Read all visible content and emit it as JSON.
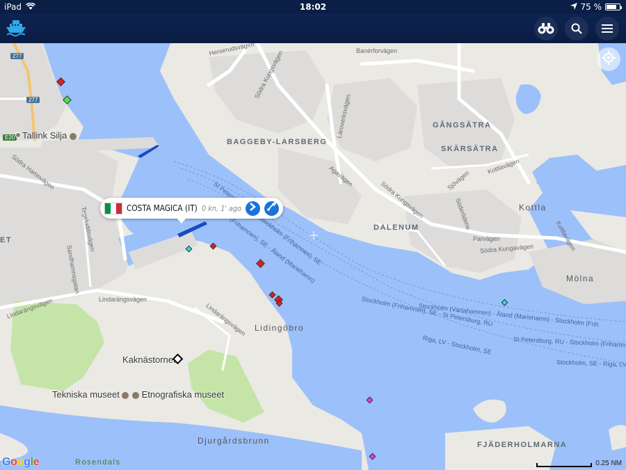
{
  "status_bar": {
    "device": "iPad",
    "time": "18:02",
    "battery_text": "75 %",
    "battery_level": 0.75
  },
  "toolbar": {
    "logo_icon": "ship-logo-icon",
    "buttons": [
      "binoculars-icon",
      "search-icon",
      "menu-icon"
    ]
  },
  "map": {
    "colors": {
      "water": "#9cc0f9",
      "land": "#ebe9e4",
      "urban": "#dddcdb",
      "park": "#c5e5a8",
      "vessel": "#1a4bc4"
    },
    "area_labels": {
      "baggeby": "BAGGEBY-LARSBERG",
      "gangsatra": "GÅNGSÄTRA",
      "skarsatra": "SKÄRSÄTRA",
      "dalenum": "DALENUM",
      "kottla": "Kottla",
      "molna": "Mölna",
      "lidingobro": "Lidingöbro",
      "djurgardsbrunn": "Djurgårdsbrunn",
      "fjaderholmarna": "FJÄDERHOLMARNA",
      "rosendals": "Rosendals",
      "edge_et": "ET"
    },
    "street_labels": {
      "herserud": "Herserudsvägen",
      "baner": "Banérforvägen",
      "sodra_kung1": "Södra Kungsvägen",
      "larove": "Läroverksvägen",
      "agavagen": "Agavägen",
      "sodra_kung2": "Södra Kungsvägen",
      "kottla": "Kottlavägen",
      "sjovagen": "Sjövägen",
      "soderlidens": "Söderlidens",
      "sodra_kung3": "Södra Kungavägen",
      "kottlav2": "Kottlavägen",
      "parvagen": "Parvägen",
      "sodra_hamn": "Södra Hamnvägen",
      "tegeludd": "Tegeluddsvägen",
      "sandhamn": "Sandhamnsgatan",
      "lindarang": "Lindarängsvägen",
      "lindarang2": "Lindarängsvägen",
      "lindarang3": "Lindarängsvägen"
    },
    "route_labels": {
      "r1": "Stockholm (Frihamnen), SE - Åland (Mariehamn)",
      "r2": "St Petersburg, RU - Stockholm (Frihamnen), SE",
      "r3": "Stockholm (Frihamnen), SE - St Petersburg, RU",
      "r4": "Stockholm (Värtahamnen) - Åland (Mariehamn) - Stockholm (Frih",
      "r5": "St Petersburg, RU - Stockholm (Frihamn",
      "r6": "Riga, LV - Stockholm, SE",
      "r7": "Stockholm, SE - Riga, LV"
    },
    "road_shields": [
      "277",
      "277",
      "E20"
    ],
    "pois": {
      "tallink": "Tallink Silja",
      "kaknastornet": "Kaknästornet",
      "tekniska": "Tekniska museet",
      "etnografiska": "Etnografiska museet"
    },
    "scale_label": "0.25 NM",
    "attribution": "Google"
  },
  "vessel_popup": {
    "name": "COSTA MAGICA (IT)",
    "info": "0 kn, 1' ago",
    "flag": "flag-italy-icon",
    "flag_colors": [
      "#009246",
      "#ffffff",
      "#ce2b37"
    ]
  }
}
